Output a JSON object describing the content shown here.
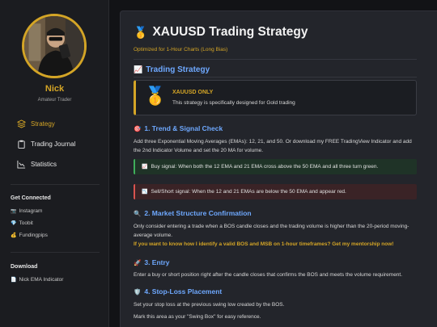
{
  "profile": {
    "name": "Nick",
    "role": "Amateur Trader"
  },
  "nav": [
    {
      "label": "Strategy",
      "icon": "layers-icon",
      "active": true
    },
    {
      "label": "Trading Journal",
      "icon": "clipboard-icon",
      "active": false
    },
    {
      "label": "Statistics",
      "icon": "chart-icon",
      "active": false
    }
  ],
  "get_connected": {
    "title": "Get Connected",
    "links": [
      {
        "label": "Instagram",
        "icon": "camera-icon",
        "emoji": "📷"
      },
      {
        "label": "Toobit",
        "icon": "diamond-icon",
        "emoji": "💎"
      },
      {
        "label": "Fundingpips",
        "icon": "money-bag-icon",
        "emoji": "💰"
      }
    ]
  },
  "download": {
    "title": "Download",
    "links": [
      {
        "label": "Nick EMA Indicator",
        "icon": "document-icon",
        "emoji": "📄"
      }
    ]
  },
  "main": {
    "title_emoji": "🥇",
    "title": "XAUUSD Trading Strategy",
    "subtitle": "Optimized for 1-Hour Charts (Long Bias)",
    "section_heading_emoji": "📈",
    "section_heading": "Trading Strategy",
    "gold_box": {
      "emoji": "🥇",
      "title": "XAUUSD ONLY",
      "text": "This strategy is specifically designed for Gold trading"
    },
    "step1": {
      "emoji": "🎯",
      "heading": "1. Trend & Signal Check",
      "text": "Add three Exponential Moving Averages (EMAs): 12, 21, and 50. Or download my FREE TradingView Indicator and add the 2nd Indicator Volume and set the 20 MA for volume.",
      "buy_emoji": "📈",
      "buy": "Buy signal: When both the 12 EMA and 21 EMA cross above the 50 EMA and all three turn green.",
      "sell_emoji": "📉",
      "sell": "Sell/Short signal: When the 12 and 21 EMAs are below the 50 EMA and appear red."
    },
    "step2": {
      "emoji": "🔍",
      "heading": "2. Market Structure Confirmation",
      "text": "Only consider entering a trade when a BOS candle closes and the trading volume is higher than the 20-period moving-average volume.",
      "highlight": "If you want to know how I identify a valid BOS and MSB on 1-hour timeframes? Get my mentorship now!"
    },
    "step3": {
      "emoji": "🚀",
      "heading": "3. Entry",
      "text": "Enter a buy or short position right after the candle closes that confirms the BOS and meets the volume requirement."
    },
    "step4": {
      "emoji": "🛡️",
      "heading": "4. Stop-Loss Placement",
      "text1": "Set your stop loss at the previous swing low created by the BOS.",
      "text2": "Mark this area as your \"Swing Box\" for easy reference."
    }
  },
  "colors": {
    "accent_gold": "#d4a526",
    "heading_blue": "#6ea8fe",
    "buy_green": "#3fae5a",
    "sell_red": "#d9534f"
  }
}
